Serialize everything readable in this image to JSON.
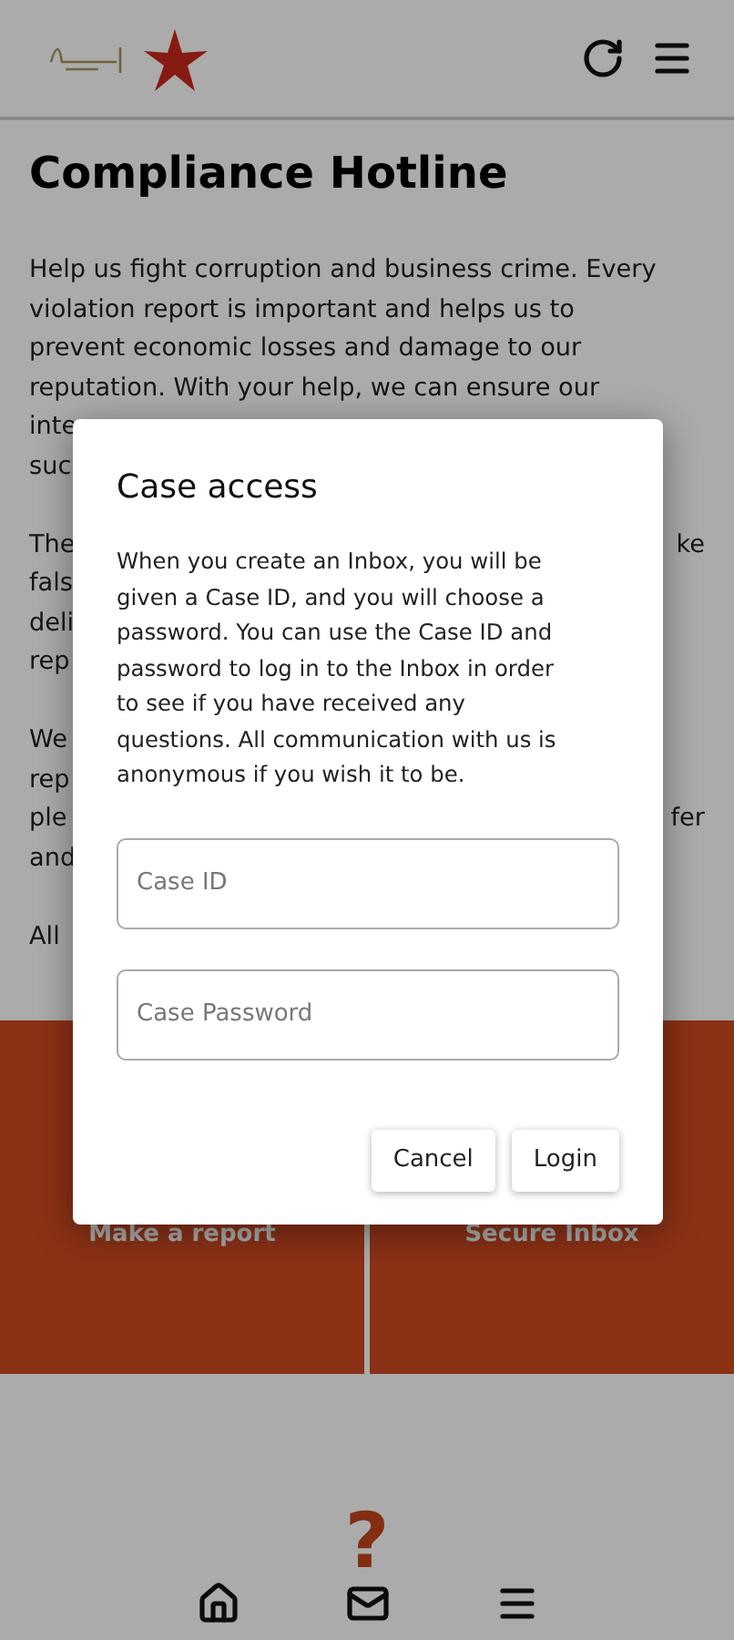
{
  "header": {
    "actions": [
      {
        "kind": "refresh"
      },
      {
        "kind": "menu"
      }
    ]
  },
  "title": "Compliance Hotline",
  "paragraphs": [
    {
      "lines": [
        {
          "left": "Help us fight corruption and business crime. Every"
        },
        {
          "left": "violation report is important and helps us to"
        },
        {
          "left": "prevent economic losses and damage to our"
        },
        {
          "left": "reputation. With your help, we can ensure our"
        },
        {
          "left": "inte"
        },
        {
          "left": "suc"
        }
      ]
    },
    {
      "lines": [
        {
          "left": "The",
          "right": "ke"
        },
        {
          "left": "fals"
        },
        {
          "left": "deli"
        },
        {
          "left": "rep"
        }
      ]
    },
    {
      "lines": [
        {
          "left": "We"
        },
        {
          "left": "rep"
        },
        {
          "left": "ple",
          "right": "fer"
        },
        {
          "left": "and"
        }
      ]
    },
    {
      "lines": [
        {
          "left": "All"
        }
      ]
    }
  ],
  "tiles": [
    "Make a report",
    "Secure Inbox"
  ],
  "help_mark": "?",
  "bottom_nav": [
    {
      "kind": "home"
    },
    {
      "kind": "mail"
    },
    {
      "kind": "menu"
    }
  ],
  "dialog": {
    "title": "Case access",
    "text": "When you create an Inbox, you will be given a Case ID, and you will choose a password. You can use the Case ID and password to log in to the Inbox in order to see if you have received any questions. All communication with us is anonymous if you wish it to be.",
    "fields": [
      {
        "placeholder": "Case ID"
      },
      {
        "placeholder": "Case Password"
      }
    ],
    "buttons": [
      "Cancel",
      "Login"
    ]
  }
}
